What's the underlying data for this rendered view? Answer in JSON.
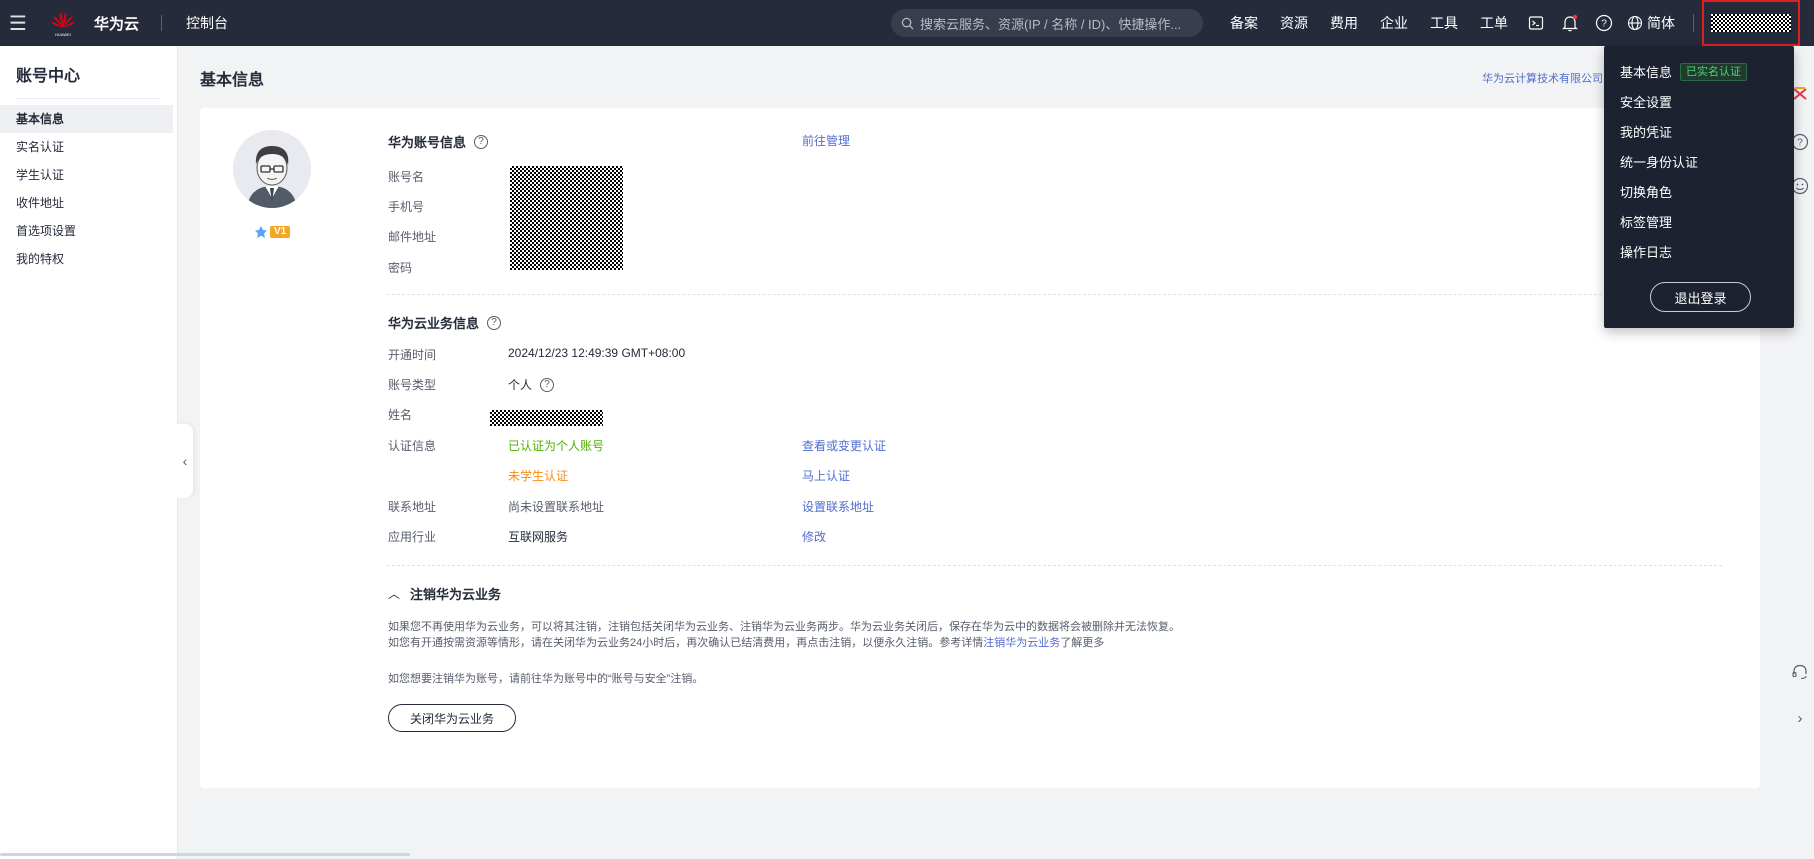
{
  "topbar": {
    "brand": "华为云",
    "logo_sub": "HUAWEI",
    "console": "控制台",
    "search_placeholder": "搜索云服务、资源(IP / 名称 / ID)、快捷操作...",
    "nav": [
      "备案",
      "资源",
      "费用",
      "企业",
      "工具",
      "工单"
    ],
    "lang": "简体",
    "icons": [
      "terminal-icon",
      "bell-icon",
      "help-icon",
      "globe-icon"
    ]
  },
  "sidebar": {
    "title": "账号中心",
    "items": [
      {
        "label": "基本信息",
        "active": true
      },
      {
        "label": "实名认证",
        "active": false
      },
      {
        "label": "学生认证",
        "active": false
      },
      {
        "label": "收件地址",
        "active": false
      },
      {
        "label": "首选项设置",
        "active": false
      },
      {
        "label": "我的特权",
        "active": false
      }
    ]
  },
  "main": {
    "page_title": "基本信息",
    "company_link": "华为云计算技术有限公司",
    "vip_level": "V1",
    "account_section": {
      "title": "华为账号信息",
      "manage_link": "前往管理",
      "labels": [
        "账号名",
        "手机号",
        "邮件地址",
        "密码"
      ]
    },
    "business_section": {
      "title": "华为云业务信息",
      "open_time_label": "开通时间",
      "open_time": "2024/12/23 12:49:39 GMT+08:00",
      "account_type_label": "账号类型",
      "account_type": "个人",
      "name_label": "姓名",
      "auth_label": "认证信息",
      "auth_status": "已认证为个人账号",
      "auth_link": "查看或变更认证",
      "student_status": "未学生认证",
      "student_link": "马上认证",
      "address_label": "联系地址",
      "address_value": "尚未设置联系地址",
      "address_link": "设置联系地址",
      "industry_label": "应用行业",
      "industry_value": "互联网服务",
      "industry_link": "修改"
    },
    "cancel_section": {
      "title": "注销华为云业务",
      "para1": "如果您不再使用华为云业务，可以将其注销，注销包括关闭华为云业务、注销华为云业务两步。华为云业务关闭后，保存在华为云中的数据将会被删除并无法恢复。",
      "para2_prefix": "如您有开通按需资源等情形，请在关闭华为云业务24小时后，再次确认已结清费用，再点击注销，以便永久注销。参考详情",
      "para2_link": "注销华为云业务",
      "para2_suffix": "了解更多",
      "para3": "如您想要注销华为账号，请前往华为账号中的“账号与安全”注销。",
      "close_button": "关闭华为云业务"
    }
  },
  "dropdown": {
    "items": [
      "基本信息",
      "安全设置",
      "我的凭证",
      "统一身份认证",
      "切换角色",
      "标签管理",
      "操作日志"
    ],
    "verified_tag": "已实名认证",
    "logout": "退出登录"
  },
  "colors": {
    "topbar_bg": "#252b3a",
    "link": "#526ecc",
    "verified_green": "#50b000",
    "unverified_orange": "#fa8c16",
    "highlight_red": "#e02020"
  }
}
